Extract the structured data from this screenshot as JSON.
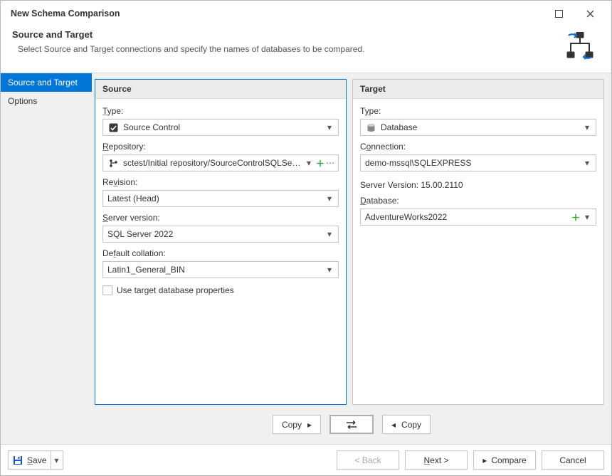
{
  "window": {
    "title": "New Schema Comparison"
  },
  "header": {
    "title": "Source and Target",
    "description": "Select Source and Target connections and specify the names of databases to be compared."
  },
  "sidebar": {
    "items": [
      {
        "label": "Source and Target",
        "selected": true
      },
      {
        "label": "Options",
        "selected": false
      }
    ]
  },
  "source": {
    "title": "Source",
    "type_label": "Type:",
    "type_value": "Source Control",
    "repository_label": "Repository:",
    "repository_value": "sctest/Initial repository/SourceControlSQLServer (Sour…",
    "revision_label": "Revision:",
    "revision_value": "Latest (Head)",
    "server_version_label": "Server version:",
    "server_version_value": "SQL Server 2022",
    "collation_label": "Default collation:",
    "collation_value": "Latin1_General_BIN",
    "use_target_label": "Use target database properties"
  },
  "target": {
    "title": "Target",
    "type_label": "Type:",
    "type_value": "Database",
    "connection_label": "Connection:",
    "connection_value": "demo-mssql\\SQLEXPRESS",
    "server_version_text": "Server Version: 15.00.2110",
    "database_label": "Database:",
    "database_value": "AdventureWorks2022"
  },
  "midbar": {
    "copy_right": "Copy",
    "copy_left": "Copy"
  },
  "footer": {
    "save": "Save",
    "back": "< Back",
    "next": "Next >",
    "compare": "Compare",
    "cancel": "Cancel"
  }
}
